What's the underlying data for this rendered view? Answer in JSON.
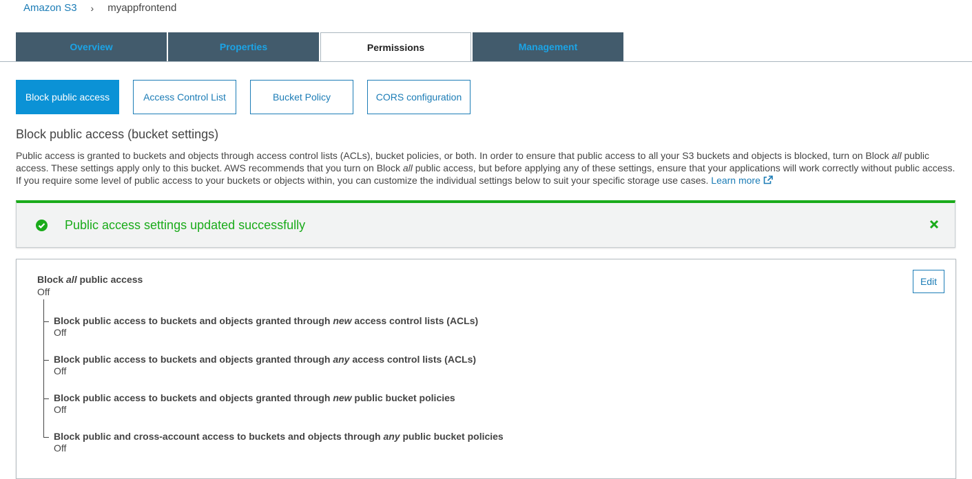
{
  "breadcrumb": {
    "root": "Amazon S3",
    "separator": "›",
    "current": "myappfrontend"
  },
  "tabs": [
    {
      "label": "Overview"
    },
    {
      "label": "Properties"
    },
    {
      "label": "Permissions"
    },
    {
      "label": "Management"
    }
  ],
  "subtabs": [
    {
      "label": "Block public access"
    },
    {
      "label": "Access Control List"
    },
    {
      "label": "Bucket Policy"
    },
    {
      "label": "CORS configuration"
    }
  ],
  "section": {
    "title": "Block public access (bucket settings)",
    "desc_1": "Public access is granted to buckets and objects through access control lists (ACLs), bucket policies, or both. In order to ensure that public access to all your S3 buckets and objects is blocked, turn on Block ",
    "desc_all_1": "all",
    "desc_2": " public access. These settings apply only to this bucket. AWS recommends that you turn on Block ",
    "desc_all_2": "all",
    "desc_3": " public access, but before applying any of these settings, ensure that your applications will work correctly without public access. If you require some level of public access to your buckets or objects within, you can customize the individual settings below to suit your specific storage use cases. ",
    "learn_more": "Learn more"
  },
  "flash": {
    "message": "Public access settings updated successfully"
  },
  "settings": {
    "edit_label": "Edit",
    "master": {
      "prefix": "Block ",
      "emph": "all",
      "suffix": " public access",
      "value": "Off"
    },
    "items": [
      {
        "prefix": "Block public access to buckets and objects granted through ",
        "emph": "new",
        "suffix": " access control lists (ACLs)",
        "value": "Off"
      },
      {
        "prefix": "Block public access to buckets and objects granted through ",
        "emph": "any",
        "suffix": " access control lists (ACLs)",
        "value": "Off"
      },
      {
        "prefix": "Block public access to buckets and objects granted through ",
        "emph": "new",
        "suffix": " public bucket policies",
        "value": "Off"
      },
      {
        "prefix": "Block public and cross-account access to buckets and objects through ",
        "emph": "any",
        "suffix": " public bucket policies",
        "value": "Off"
      }
    ]
  },
  "colors": {
    "accent": "#0b92d6",
    "link": "#1b7cb6",
    "success": "#1aab1a",
    "tab_bg": "#425b6c"
  }
}
